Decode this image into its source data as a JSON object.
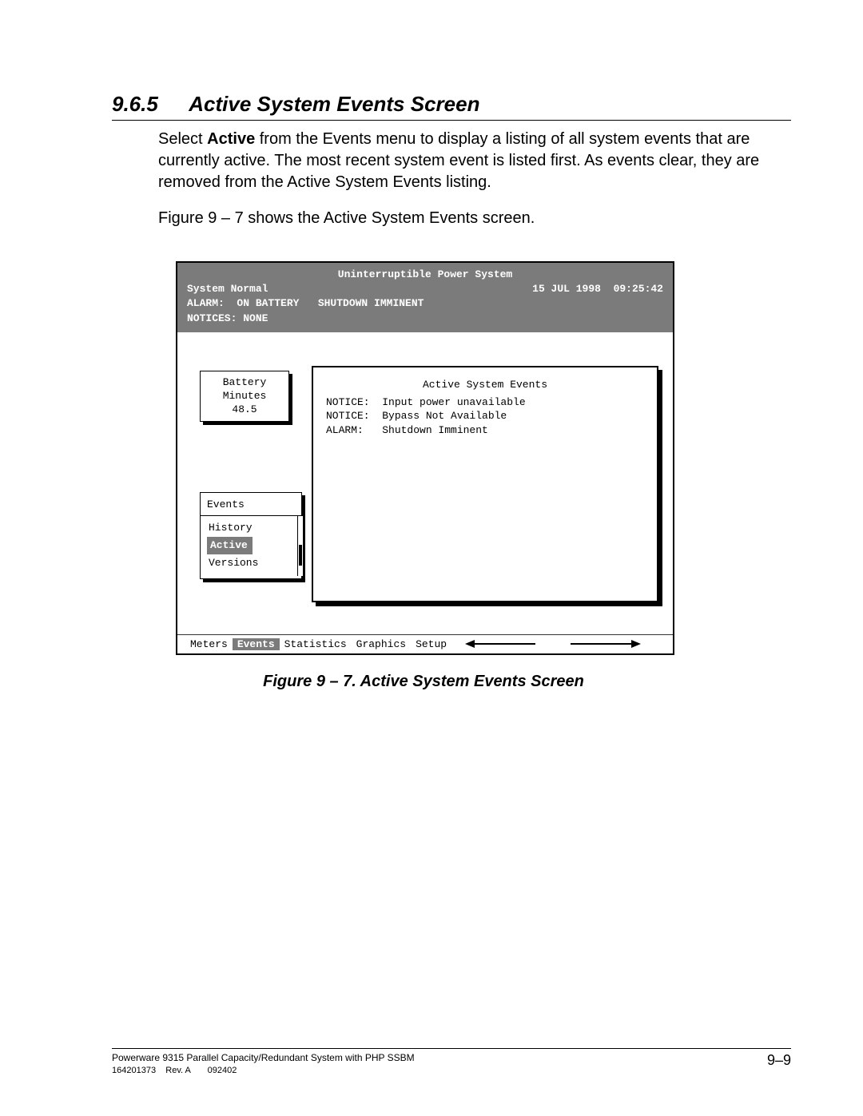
{
  "section": {
    "number": "9.6.5",
    "title": "Active System Events Screen"
  },
  "paragraphs": {
    "p1a": "Select ",
    "p1b": "Active",
    "p1c": " from the Events menu to display a listing of all system events that are currently active.  The most recent system event is listed first.  As events clear, they are removed from the Active System Events listing.",
    "p2": "Figure 9 – 7 shows the Active System Events screen."
  },
  "terminal": {
    "title": "Uninterruptible Power System",
    "status": "System Normal",
    "date": "15 JUL 1998",
    "time": "09:25:42",
    "alarm_line": "ALARM:  ON BATTERY   SHUTDOWN IMMINENT",
    "notices_line": "NOTICES: NONE",
    "battery": {
      "l1": "Battery",
      "l2": "Minutes",
      "l3": "48.5"
    },
    "events_menu": {
      "title": "Events",
      "items": [
        "History",
        "Active",
        "Versions"
      ],
      "selected": "Active"
    },
    "panel": {
      "title": "Active System Events",
      "rows": [
        {
          "type": "NOTICE:",
          "msg": "Input power unavailable"
        },
        {
          "type": "NOTICE:",
          "msg": "Bypass Not Available"
        },
        {
          "type": "ALARM:",
          "msg": "Shutdown Imminent"
        }
      ]
    },
    "menubar": {
      "items": [
        "Meters",
        "Events",
        "Statistics",
        "Graphics",
        "Setup"
      ],
      "selected": "Events"
    }
  },
  "figure_caption": "Figure 9 – 7.   Active System Events Screen",
  "footer": {
    "line1": "Powerware 9315 Parallel Capacity/Redundant System with PHP SSBM",
    "line2": "164201373    Rev. A       092402",
    "page": "9–9"
  }
}
